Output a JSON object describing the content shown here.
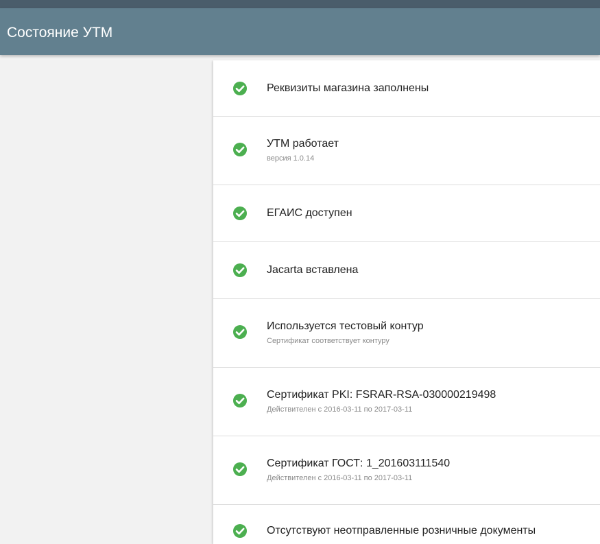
{
  "header": {
    "title": "Состояние УТМ"
  },
  "status_items": [
    {
      "icon": "check-circle-icon",
      "title": "Реквизиты магазина заполнены",
      "subtitle": ""
    },
    {
      "icon": "check-circle-icon",
      "title": "УТМ работает",
      "subtitle": "версия 1.0.14"
    },
    {
      "icon": "check-circle-icon",
      "title": "ЕГАИС доступен",
      "subtitle": ""
    },
    {
      "icon": "check-circle-icon",
      "title": "Jacarta вставлена",
      "subtitle": ""
    },
    {
      "icon": "check-circle-icon",
      "title": "Используется тестовый контур",
      "subtitle": "Сертификат соответствует контуру"
    },
    {
      "icon": "check-circle-icon",
      "title": "Сертификат PKI: FSRAR-RSA-030000219498",
      "subtitle": "Действителен с 2016-03-11 по 2017-03-11"
    },
    {
      "icon": "check-circle-icon",
      "title": "Сертификат ГОСТ: 1_201603111540",
      "subtitle": "Действителен с 2016-03-11 по 2017-03-11"
    },
    {
      "icon": "check-circle-icon",
      "title": "Отсутствуют неотправленные розничные документы",
      "subtitle": ""
    }
  ],
  "colors": {
    "app_bar": "#62808f",
    "success_green": "#4caf50"
  }
}
